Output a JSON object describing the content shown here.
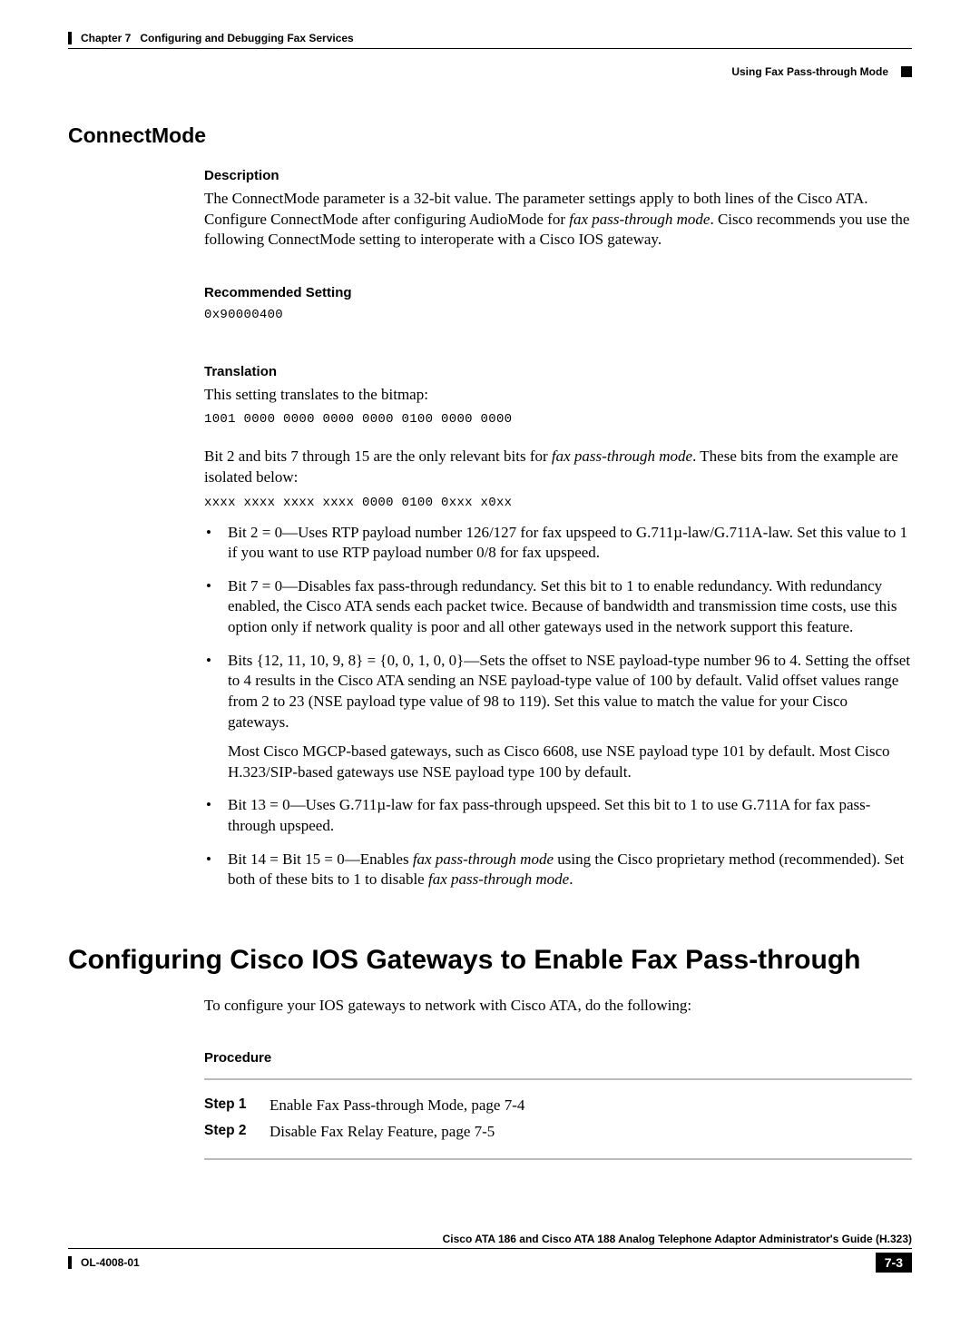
{
  "header": {
    "chapter": "Chapter 7",
    "chapter_title": "Configuring and Debugging Fax Services",
    "section": "Using Fax Pass-through Mode"
  },
  "connectmode": {
    "title": "ConnectMode",
    "description_label": "Description",
    "description_p1_a": "The ConnectMode parameter is a 32-bit value.  The parameter settings apply to both lines of the Cisco ATA. Configure ConnectMode after configuring AudioMode for ",
    "description_p1_italic": "fax pass-through mode",
    "description_p1_b": ". Cisco recommends you use the following ConnectMode setting to interoperate with a Cisco IOS gateway.",
    "recommended_label": "Recommended Setting",
    "recommended_value": "0x90000400",
    "translation_label": "Translation",
    "translation_intro": "This setting translates to the bitmap:",
    "translation_bitmap": "1001 0000 0000 0000 0000 0100 0000 0000",
    "bits_intro_a": "Bit 2 and bits 7 through 15 are the only relevant bits for ",
    "bits_intro_italic": "fax pass-through mode",
    "bits_intro_b": ". These bits from the example are isolated below:",
    "bits_isolated": "xxxx xxxx xxxx xxxx 0000 0100 0xxx x0xx",
    "bullets": {
      "b1": "Bit 2 = 0—Uses RTP payload number 126/127 for fax upspeed to G.711µ-law/G.711A-law. Set this value to 1 if you want to use RTP payload number 0/8 for fax upspeed.",
      "b2": "Bit 7 = 0—Disables fax pass-through redundancy.  Set this bit to 1 to enable redundancy. With redundancy enabled, the Cisco ATA sends each packet twice. Because of bandwidth and transmission time costs, use this option only if network quality is poor and all other gateways used in the network support this feature.",
      "b3a": "Bits {12, 11, 10, 9, 8} = {0, 0, 1, 0, 0}—Sets the offset to NSE payload-type number 96 to 4.  Setting the offset to 4 results in the Cisco ATA sending an NSE payload-type value of 100 by default. Valid offset values range from 2 to 23 (NSE payload type value of 98 to 119). Set this value to match the value for your Cisco gateways.",
      "b3b": "Most Cisco MGCP-based gateways, such as Cisco 6608, use NSE payload type 101 by default. Most Cisco H.323/SIP-based gateways use NSE payload type 100 by default.",
      "b4": "Bit 13 = 0—Uses G.711µ-law for fax pass-through upspeed.  Set this bit to 1 to use G.711A for fax pass-through upspeed.",
      "b5_a": "Bit 14 = Bit 15 = 0—Enables ",
      "b5_i1": "fax pass-through mode",
      "b5_b": " using the Cisco proprietary method (recommended).  Set both of these bits to 1 to disable ",
      "b5_i2": "fax pass-through mode",
      "b5_c": "."
    }
  },
  "ios": {
    "title": "Configuring Cisco IOS Gateways to Enable Fax Pass-through",
    "intro": "To configure your IOS gateways to network with Cisco ATA, do the following:",
    "procedure_label": "Procedure",
    "steps": {
      "s1_label": "Step 1",
      "s1_text": "Enable Fax Pass-through Mode, page 7-4",
      "s2_label": "Step 2",
      "s2_text": "Disable Fax Relay Feature, page 7-5"
    }
  },
  "footer": {
    "doc_title": "Cisco ATA 186 and Cisco ATA 188 Analog Telephone Adaptor Administrator's Guide (H.323)",
    "doc_id": "OL-4008-01",
    "page_num": "7-3"
  }
}
